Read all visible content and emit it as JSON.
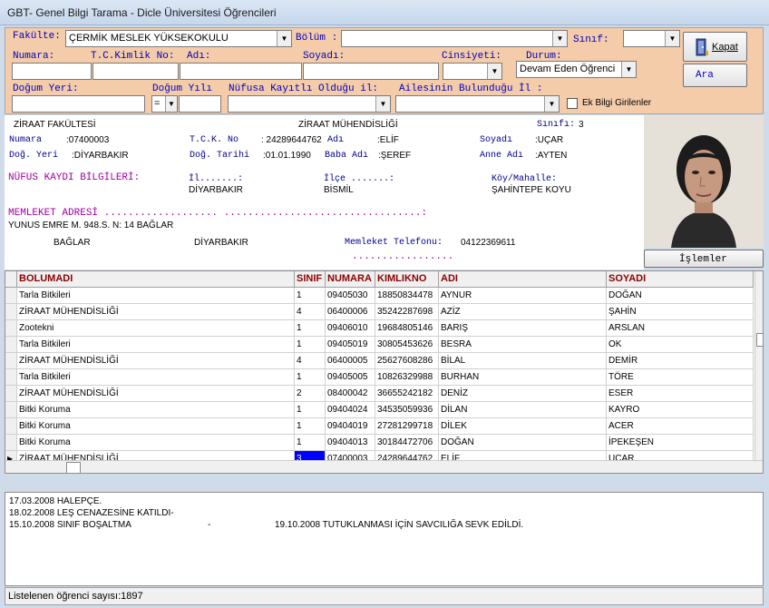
{
  "window": {
    "title": "GBT- Genel Bilgi Tarama - Dicle Üniversitesi Öğrencileri"
  },
  "search": {
    "fakulte_label": "Fakülte:",
    "fakulte_value": "ÇERMİK  MESLEK YÜKSEKOKULU",
    "bolum_label": "Bölüm :",
    "bolum_value": "",
    "sinif_label": "Sınıf:",
    "sinif_value": "",
    "numara_label": "Numara:",
    "numara_value": "",
    "tc_label": "T.C.Kimlik No:",
    "tc_value": "",
    "adi_label": "Adı:",
    "adi_value": "",
    "soyadi_label": "Soyadı:",
    "soyadi_value": "",
    "cinsiyet_label": "Cinsiyeti:",
    "cinsiyet_value": "",
    "durum_label": "Durum:",
    "durum_value": "Devam Eden Öğrenci",
    "dogum_yeri_label": "Doğum Yeri:",
    "dogum_yeri_value": "",
    "dogum_yili_label": "Doğum Yılı",
    "dogum_yili_op": "=",
    "dogum_yili_value": "",
    "nufus_il_label": "Nüfusa Kayıtlı Olduğu il:",
    "nufus_il_value": "",
    "aile_il_label": "Ailesinin Bulunduğu İl :",
    "aile_il_value": "",
    "ek_bilgi_label": "Ek Bilgi Girilenler",
    "kapat_label": "Kapat",
    "ara_label": "Ara"
  },
  "detail": {
    "fakulte": "ZİRAAT FAKÜLTESİ",
    "bolum": "ZİRAAT MÜHENDİSLİĞİ",
    "sinif_label": "Sınıfı:",
    "sinif": "3",
    "numara_label": "Numara",
    "numara": ":07400003",
    "tck_label": "T.C.K. No",
    "tck": ": 24289644762",
    "adi_label": "Adı",
    "adi": ":ELİF",
    "soyadi_label": "Soyadı",
    "soyadi": ":UÇAR",
    "dog_yeri_label": "Doğ. Yeri",
    "dog_yeri": ":DİYARBAKIR",
    "dog_tarihi_label": "Doğ. Tarihi",
    "dog_tarihi": ":01.01.1990",
    "baba_label": "Baba Adı",
    "baba": ":ŞEREF",
    "anne_label": "Anne Adı",
    "anne": ":AYTEN",
    "nufus_title": "NÜFUS KAYDI BİLGİLERİ:",
    "il_label": "İl.......:",
    "il": "DİYARBAKIR",
    "ilce_label": "İlçe .......:",
    "ilce": "BİSMİL",
    "koy_label": "Köy/Mahalle:",
    "koy": "ŞAHİNTEPE KOYU",
    "memleket_title": "MEMLEKET ADRESİ ................... .................................:",
    "adres1": "YUNUS EMRE M. 948.S. N: 14 BAĞLAR",
    "adres_ilce": "BAĞLAR",
    "adres_il": "DİYARBAKIR",
    "tel_label": "Memleket Telefonu:",
    "tel": "04122369611",
    "dots": ".................",
    "islemler_label": "İşlemler"
  },
  "grid": {
    "columns": [
      "BOLUMADI",
      "SINIF",
      "NUMARA",
      "KIMLIKNO",
      "ADI",
      "SOYADI"
    ],
    "rows": [
      [
        "Tarla Bitkileri",
        "1",
        "09405030",
        "18850834478",
        "AYNUR",
        "DOĞAN"
      ],
      [
        "ZİRAAT MÜHENDİSLİĞİ",
        "4",
        "06400006",
        "35242287698",
        "AZİZ",
        "ŞAHİN"
      ],
      [
        "Zootekni",
        "1",
        "09406010",
        "19684805146",
        "BARIŞ",
        "ARSLAN"
      ],
      [
        "Tarla Bitkileri",
        "1",
        "09405019",
        "30805453626",
        "BESRA",
        "OK"
      ],
      [
        "ZİRAAT MÜHENDİSLİĞİ",
        "4",
        "06400005",
        "25627608286",
        "BİLAL",
        "DEMİR"
      ],
      [
        "Tarla Bitkileri",
        "1",
        "09405005",
        "10826329988",
        "BURHAN",
        "TÖRE"
      ],
      [
        "ZİRAAT MÜHENDİSLİĞİ",
        "2",
        "08400042",
        "36655242182",
        "DENİZ",
        "ESER"
      ],
      [
        "Bitki Koruma",
        "1",
        "09404024",
        "34535059936",
        "DİLAN",
        "KAYRO"
      ],
      [
        "Bitki Koruma",
        "1",
        "09404019",
        "27281299718",
        "DİLEK",
        "ACER"
      ],
      [
        "Bitki Koruma",
        "1",
        "09404013",
        "30184472706",
        "DOĞAN",
        "İPEKEŞEN"
      ],
      [
        "ZİRAAT MÜHENDİSLİĞİ",
        "3",
        "07400003",
        "24289644762",
        "ELİF",
        "UÇAR"
      ]
    ],
    "selected_row": 10
  },
  "notes": {
    "line1": "17.03.2008 HALEPÇE.",
    "line2": "18.02.2008 LEŞ CENAZESİNE KATILDI-",
    "line3a": "15.10.2008  SINIF BOŞALTMA",
    "line3b": "-",
    "line3c": "19.10.2008 TUTUKLANMASI İÇİN  SAVCILIĞA SEVK EDİLDİ."
  },
  "status": {
    "text": "Listelenen öğrenci sayısı:1897"
  },
  "colors": {
    "panel": "#f4ccaa",
    "label_blue": "#0000c0",
    "header_red": "#8b0000",
    "purple": "#a000a0",
    "selection": "#0000ff"
  }
}
